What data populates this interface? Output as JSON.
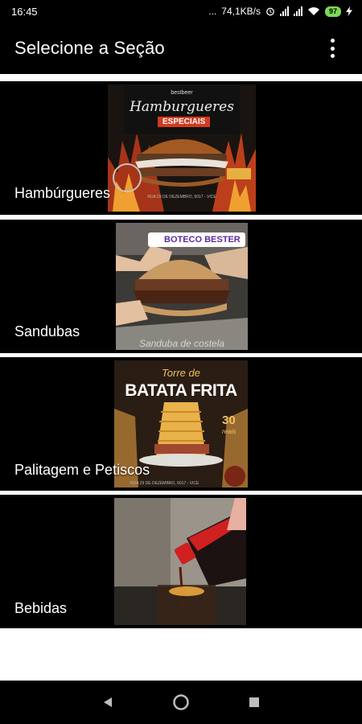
{
  "status_bar": {
    "time": "16:45",
    "extra": "...",
    "network_speed": "74,1KB/s",
    "battery": "97"
  },
  "app_bar": {
    "title": "Selecione a Seção",
    "menu_icon": "more-vert-icon"
  },
  "sections": [
    {
      "label": "Hambúrgueres",
      "poster": {
        "brand": "bestbeer",
        "title": "Hamburgueres",
        "subtitle": "ESPECIAIS",
        "footer": "RUA 29 DE DEZEMBRO, 6017 - VICE"
      }
    },
    {
      "label": "Sandubas",
      "poster": {
        "tag": "BOTECO BESTER",
        "caption": "Sanduba de costela"
      }
    },
    {
      "label": "Palitagem e Petiscos",
      "poster": {
        "title_small": "Torre de",
        "title": "BATATA FRITA",
        "price": "30",
        "price_unit": "reais",
        "footer": "RUA 29 DE DEZEMBRO, 6017 - VICE"
      }
    },
    {
      "label": "Bebidas",
      "poster": {}
    }
  ],
  "nav": {
    "back_icon": "back-icon",
    "home_icon": "home-icon",
    "recents_icon": "recents-icon"
  }
}
